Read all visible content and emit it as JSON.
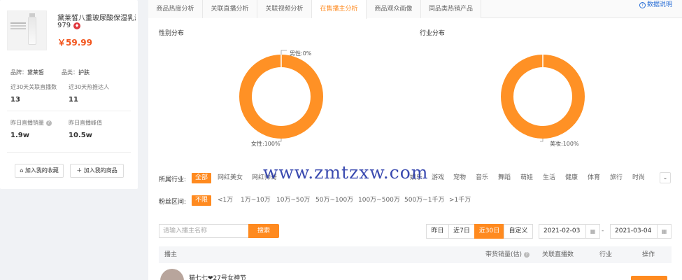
{
  "product": {
    "name": "黛莱皙八重玻尿酸保湿乳液A",
    "name_line2": "979",
    "hot_icon": "hot-icon",
    "price": "￥59.99",
    "brand_label": "品牌：",
    "brand": "黛莱皙",
    "category_label": "品类：",
    "category": "护肤",
    "stats": [
      {
        "label": "近30天关联直播数",
        "value": "13"
      },
      {
        "label": "近30天热推达人",
        "value": "11"
      },
      {
        "label": "昨日直播销量",
        "value": "1.9w"
      },
      {
        "label": "昨日直播峰值",
        "value": "10.5w"
      }
    ],
    "actions": {
      "favorite": "加入我的收藏",
      "add_goods": "加入我的商品"
    }
  },
  "tabs": [
    {
      "label": "商品热度分析",
      "active": false
    },
    {
      "label": "关联直播分析",
      "active": false
    },
    {
      "label": "关联视频分析",
      "active": false
    },
    {
      "label": "在售播主分析",
      "active": true
    },
    {
      "label": "商品观众画像",
      "active": false
    },
    {
      "label": "同品类热销产品",
      "active": false
    }
  ],
  "help": "数据说明",
  "charts": {
    "gender": {
      "title": "性别分布",
      "top_label": "男性:0%",
      "bottom_label": "女性:100%"
    },
    "industry": {
      "title": "行业分布",
      "bottom_label": "美妆:100%"
    }
  },
  "chart_data": [
    {
      "type": "pie",
      "title": "性别分布",
      "categories": [
        "男性",
        "女性"
      ],
      "values": [
        0,
        100
      ],
      "colors": [
        "#2b7fe0",
        "#ff9125"
      ]
    },
    {
      "type": "pie",
      "title": "行业分布",
      "categories": [
        "美妆"
      ],
      "values": [
        100
      ],
      "colors": [
        "#ff9125"
      ]
    }
  ],
  "filters": {
    "industry_label": "所属行业:",
    "industries": [
      "全部",
      "网红美女",
      "网红帅哥",
      "",
      "",
      "",
      "",
      "",
      "娱乐",
      "游戏",
      "宠物",
      "音乐",
      "舞蹈",
      "萌娃",
      "生活",
      "健康",
      "体育",
      "旅行",
      "时尚"
    ],
    "fans_label": "粉丝区间:",
    "fans": [
      "不限",
      "<1万",
      "1万~10万",
      "10万~50万",
      "50万~100万",
      "100万~500万",
      "500万~1千万",
      ">1千万"
    ]
  },
  "search": {
    "placeholder": "请输入播主名称",
    "button": "搜索"
  },
  "ranges": [
    "昨日",
    "近7日",
    "近30日",
    "自定义"
  ],
  "active_range": "近30日",
  "dates": {
    "start": "2021-02-03",
    "sep": "-",
    "end": "2021-03-04"
  },
  "table": {
    "headers": [
      "播主",
      "带货销量(估)",
      "关联直播数",
      "行业",
      "操作"
    ],
    "rows": [
      {
        "streamer": "猫七七❤27号女神节"
      }
    ]
  },
  "watermark": "www.zmtzxw.com",
  "colors": {
    "accent": "#ff8a1f",
    "price": "#f2551d"
  }
}
